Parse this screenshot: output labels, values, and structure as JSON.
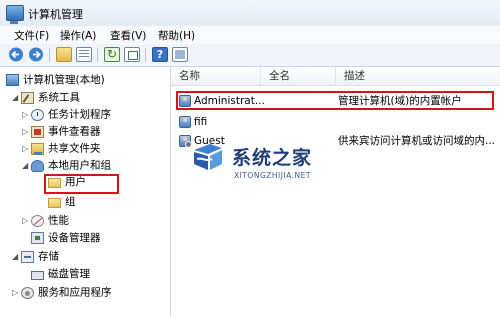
{
  "window": {
    "title": "计算机管理"
  },
  "menu": {
    "items": [
      "文件(F)",
      "操作(A)",
      "查看(V)",
      "帮助(H)"
    ]
  },
  "tree": {
    "root": "计算机管理(本地)",
    "system_tools": "系统工具",
    "task_scheduler": "任务计划程序",
    "event_viewer": "事件查看器",
    "shared_folders": "共享文件夹",
    "local_users_groups": "本地用户和组",
    "users": "用户",
    "groups": "组",
    "performance": "性能",
    "device_manager": "设备管理器",
    "storage": "存储",
    "disk_management": "磁盘管理",
    "services_apps": "服务和应用程序"
  },
  "list": {
    "columns": [
      "名称",
      "全名",
      "描述"
    ],
    "rows": [
      {
        "name": "Administrat...",
        "full_name": "",
        "description": "管理计算机(域)的内置帐户"
      },
      {
        "name": "fifi",
        "full_name": "",
        "description": ""
      },
      {
        "name": "Guest",
        "full_name": "",
        "description": "供来宾访问计算机或访问域的内..."
      }
    ]
  },
  "watermark": {
    "brand": "系统之家",
    "url": "XITONGZHIJIA.NET"
  },
  "colors": {
    "highlight": "#d4131b",
    "accent": "#2f6fb7"
  },
  "icons": [
    "back-arrow-icon",
    "forward-arrow-icon",
    "up-folder-icon",
    "show-tree-icon",
    "refresh-icon",
    "export-list-icon",
    "help-icon",
    "properties-icon"
  ]
}
